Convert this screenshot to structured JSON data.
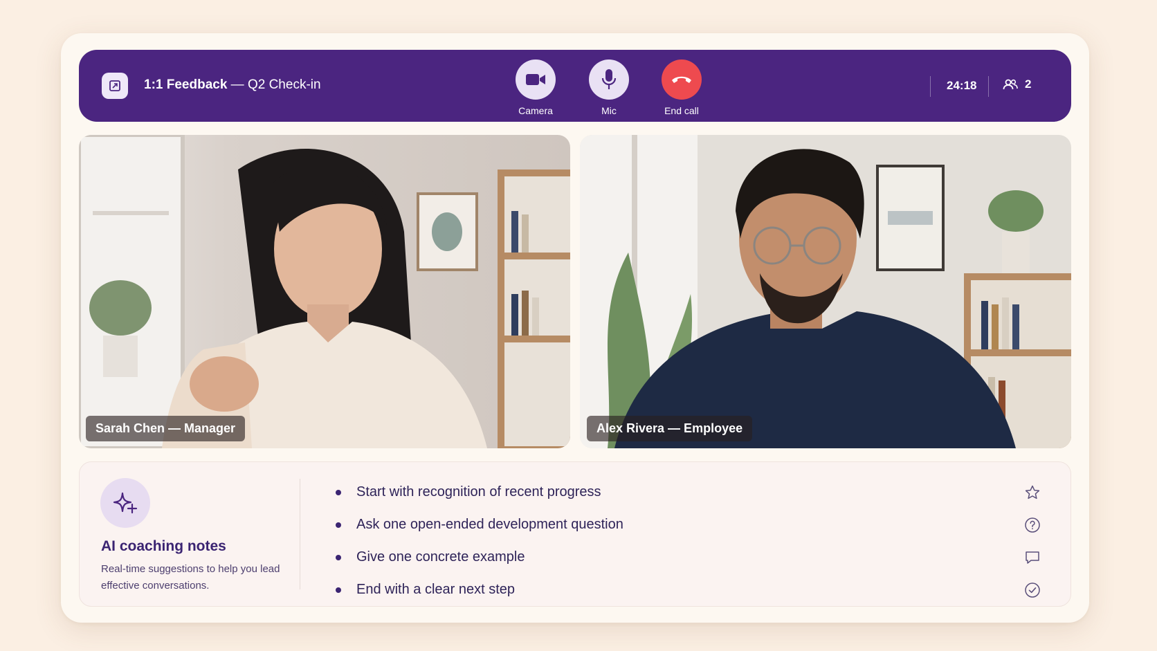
{
  "header": {
    "title_bold": "1:1 Feedback",
    "title_rest": " — Q2 Check-in",
    "timer": "24:18",
    "participant_count": "2",
    "colors": {
      "bar": "#4b2580",
      "end_call": "#ee4a4f"
    }
  },
  "controls": {
    "camera_label": "Camera",
    "mic_label": "Mic",
    "end_label": "End call"
  },
  "videos": [
    {
      "name": "Sarah Chen — Manager"
    },
    {
      "name": "Alex Rivera — Employee"
    }
  ],
  "coaching": {
    "title": "AI coaching notes",
    "subtitle": "Real-time suggestions to help you lead effective conversations.",
    "tips": [
      {
        "text": "Start with recognition of recent progress",
        "icon": "star-icon"
      },
      {
        "text": "Ask one open-ended development question",
        "icon": "question-icon"
      },
      {
        "text": "Give one concrete example",
        "icon": "chat-bubble-icon"
      },
      {
        "text": "End with a clear next step",
        "icon": "check-circle-icon"
      }
    ]
  }
}
